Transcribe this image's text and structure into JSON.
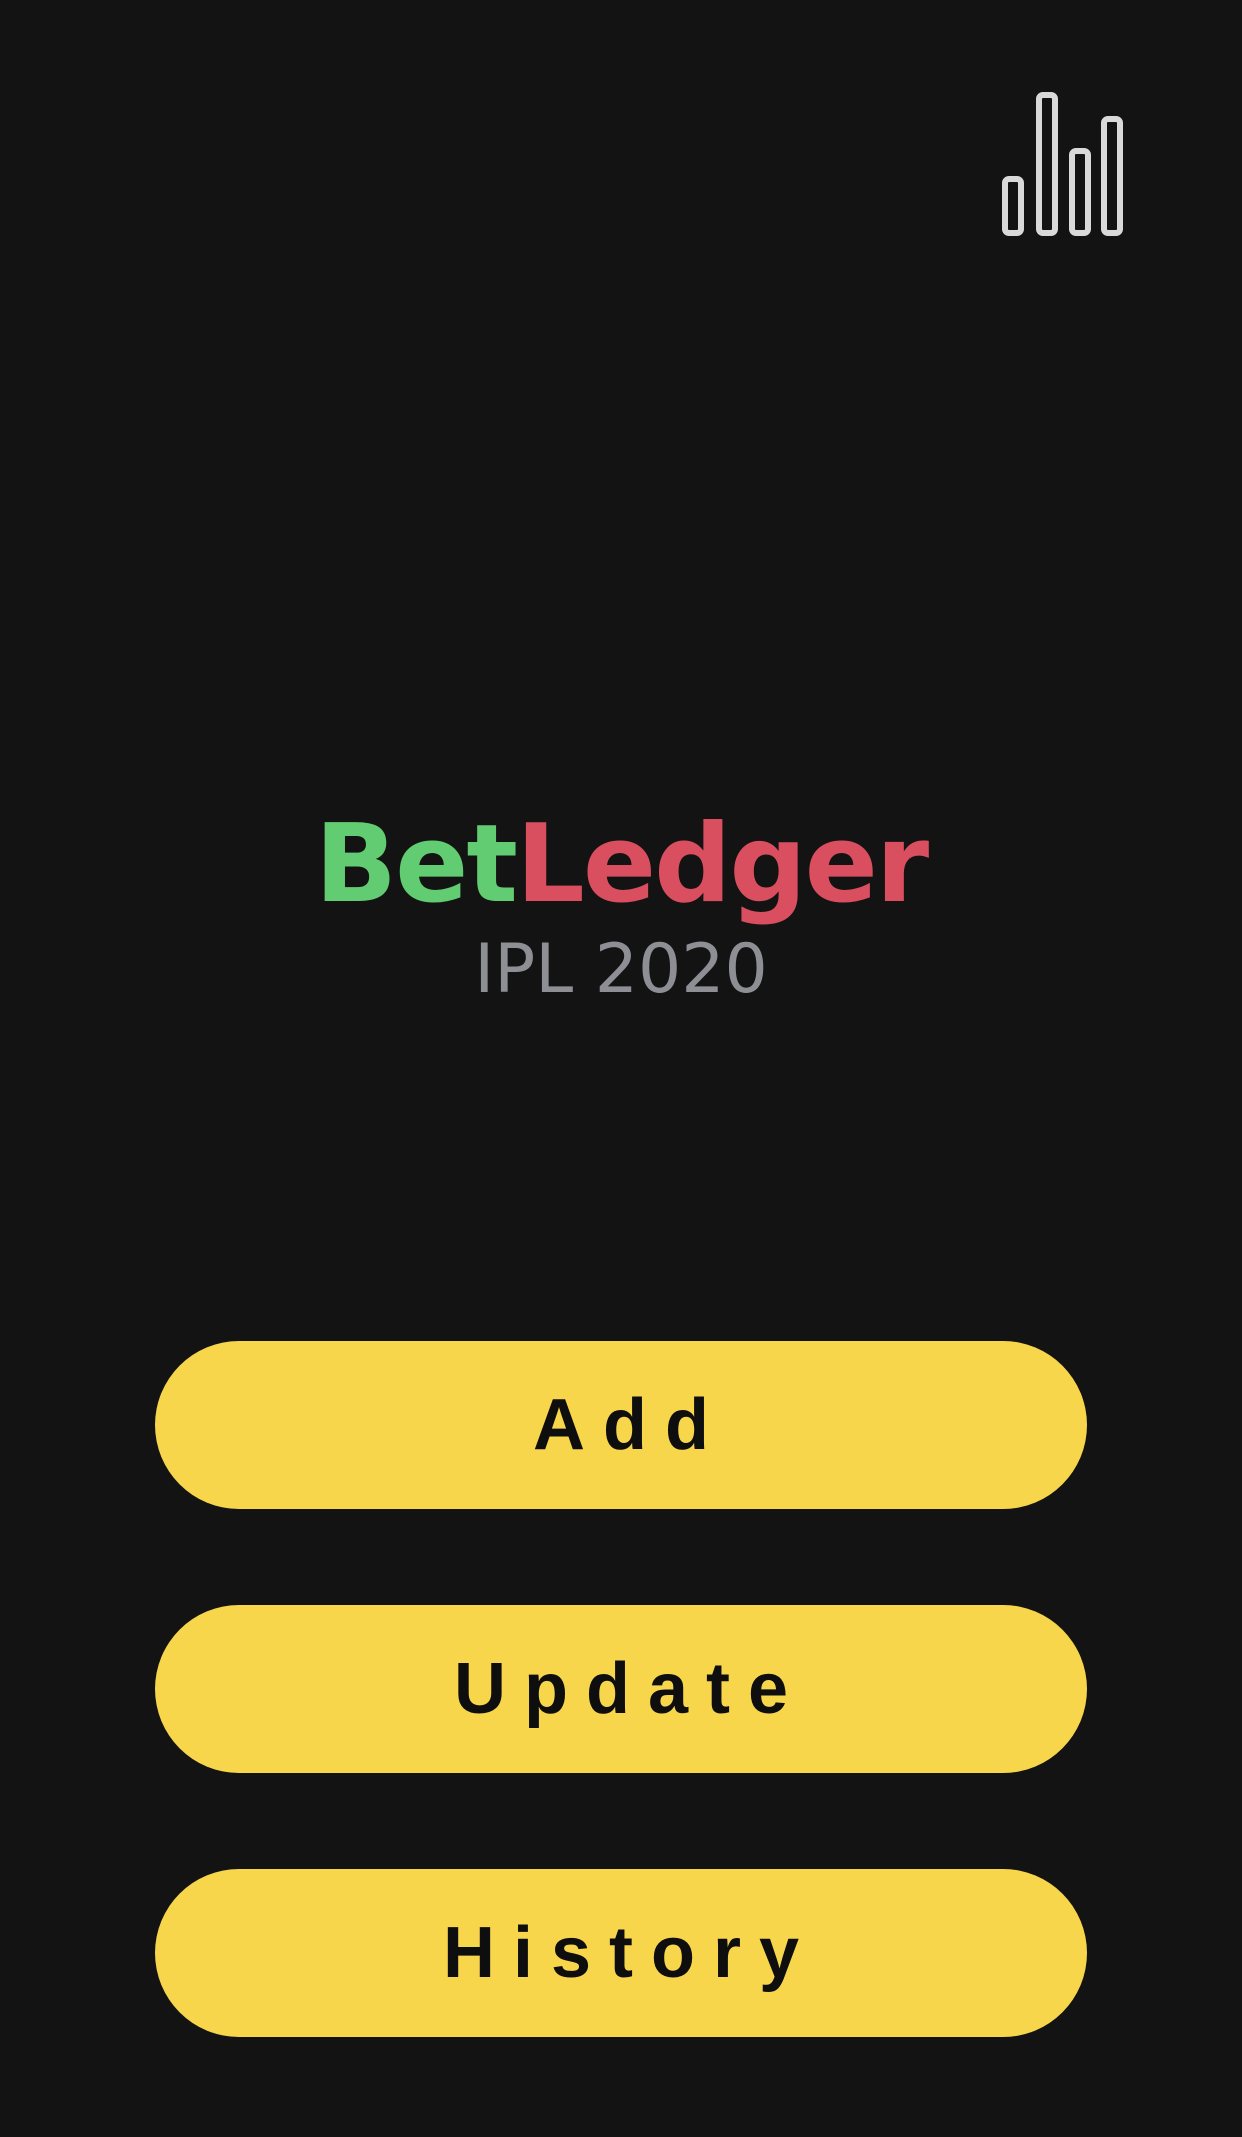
{
  "header": {
    "stats_icon": "bar-chart-icon"
  },
  "brand": {
    "part1": "Bet",
    "part2": "Ledger",
    "subtitle": "IPL 2020",
    "colors": {
      "part1": "#62CC72",
      "part2": "#DA4F60",
      "subtitle": "#8E8E95"
    }
  },
  "actions": [
    {
      "label": "Add"
    },
    {
      "label": "Update"
    },
    {
      "label": "History"
    }
  ],
  "theme": {
    "background": "#131313",
    "button_background": "#F7D64C",
    "button_text": "#0E0E0E",
    "icon_stroke": "#D9D9D9"
  }
}
